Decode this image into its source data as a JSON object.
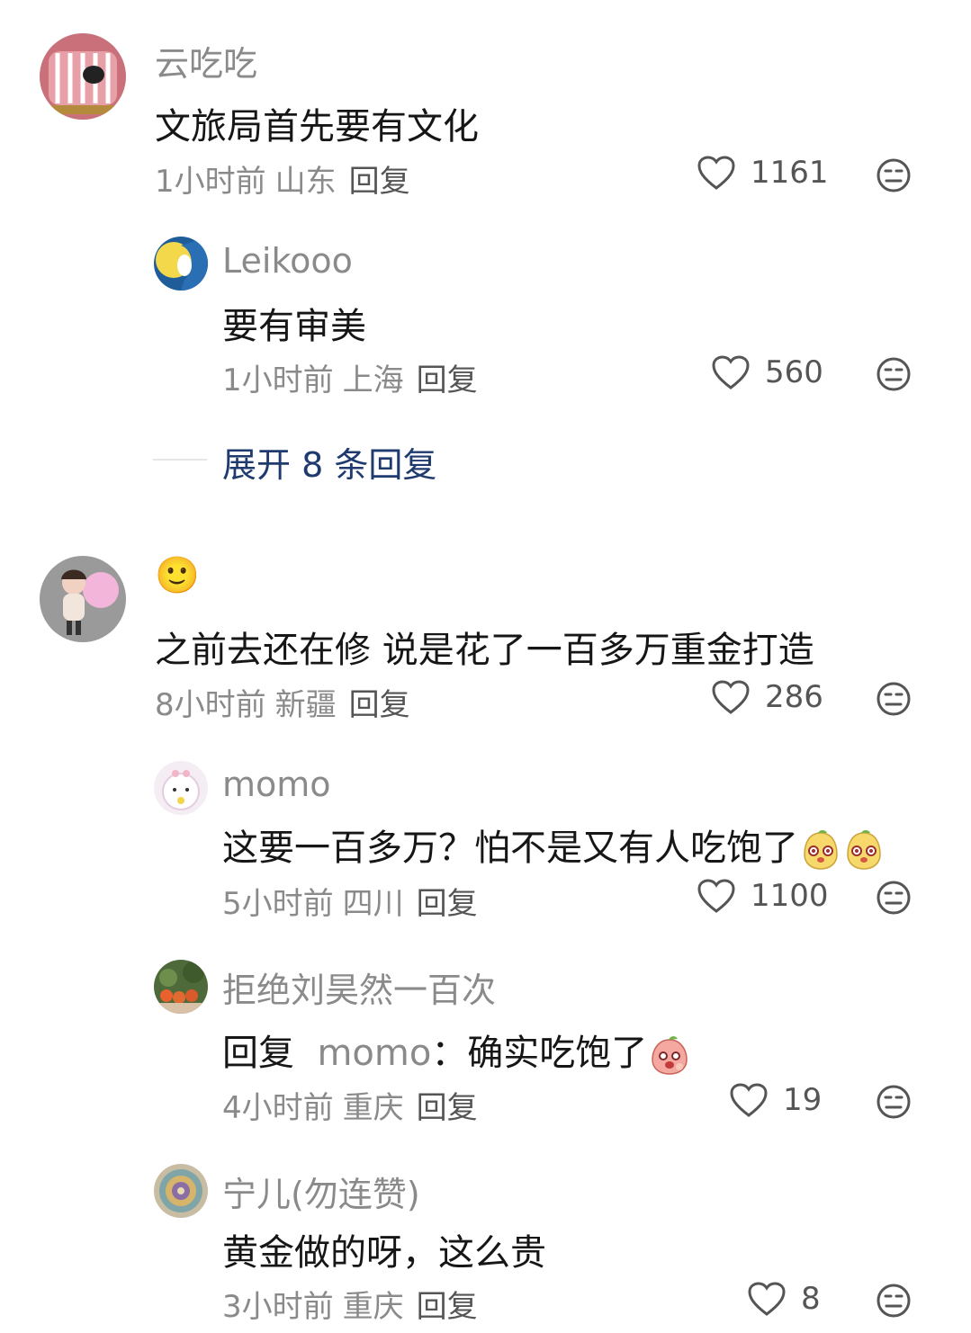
{
  "comments": [
    {
      "user": "云吃吃",
      "text": "文旅局首先要有文化",
      "time": "1小时前",
      "region": "山东",
      "reply_label": "回复",
      "likes": "1161",
      "replies": [
        {
          "user": "Leikooo",
          "text": "要有审美",
          "time": "1小时前",
          "region": "上海",
          "reply_label": "回复",
          "likes": "560"
        }
      ],
      "expand_label": "展开 8 条回复"
    },
    {
      "user": "🙂",
      "text": "之前去还在修 说是花了一百多万重金打造",
      "time": "8小时前",
      "region": "新疆",
      "reply_label": "回复",
      "likes": "286",
      "replies": [
        {
          "user": "momo",
          "text": "这要一百多万？怕不是又有人吃饱了",
          "time": "5小时前",
          "region": "四川",
          "reply_label": "回复",
          "likes": "1100"
        },
        {
          "user": "拒绝刘昊然一百次",
          "reply_prefix": "回复",
          "mention": "momo",
          "text": "：确实吃饱了",
          "time": "4小时前",
          "region": "重庆",
          "reply_label": "回复",
          "likes": "19"
        },
        {
          "user": "宁儿(勿连赞)",
          "text": "黄金做的呀，这么贵",
          "time": "3小时前",
          "region": "重庆",
          "reply_label": "回复",
          "likes": "8"
        }
      ]
    }
  ],
  "icons": {
    "like": "heart-outline-icon",
    "dislike": "meh-face-icon",
    "sticker": "yellow-bear-sticker-icon",
    "sticker2": "pink-peach-sticker-icon"
  },
  "colors": {
    "text": "#161616",
    "meta": "#8a8a8a",
    "expand": "#1e3a6e"
  }
}
